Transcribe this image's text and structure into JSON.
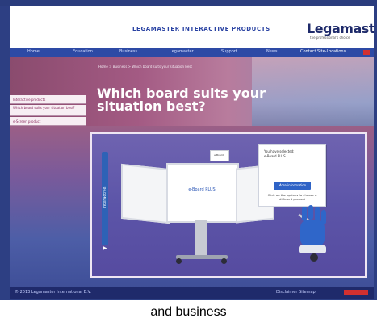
{
  "header": {
    "title": "LEGAMASTER INTERACTIVE PRODUCTS",
    "logo": "Legamaster",
    "tagline": "the professional's choice"
  },
  "nav": {
    "items": [
      "Home",
      "Education",
      "Business",
      "Legamaster",
      "Support",
      "News"
    ],
    "right": "Contact  Site-Locations"
  },
  "hero": {
    "breadcrumb": "Home > Business > Which board suits your situation best",
    "title": "Which board suits your situation best?"
  },
  "sidebar": {
    "items": [
      "Interactive products",
      "Which board suits your situation best?",
      "e-Screen product"
    ]
  },
  "panel": {
    "tab_label": "Interactive",
    "board_text": "e-Board PLUS",
    "mini_board_label": "e-Board",
    "bubble_title": "You have selected:",
    "bubble_subtitle": "e-Board PLUS",
    "bubble_button": "More information",
    "bubble_hint": "Click on the options to choose a different product"
  },
  "footer": {
    "left": "© 2013 Legamaster International B.V.",
    "right": "Disclaimer  Sitemap"
  },
  "caption": "and business"
}
